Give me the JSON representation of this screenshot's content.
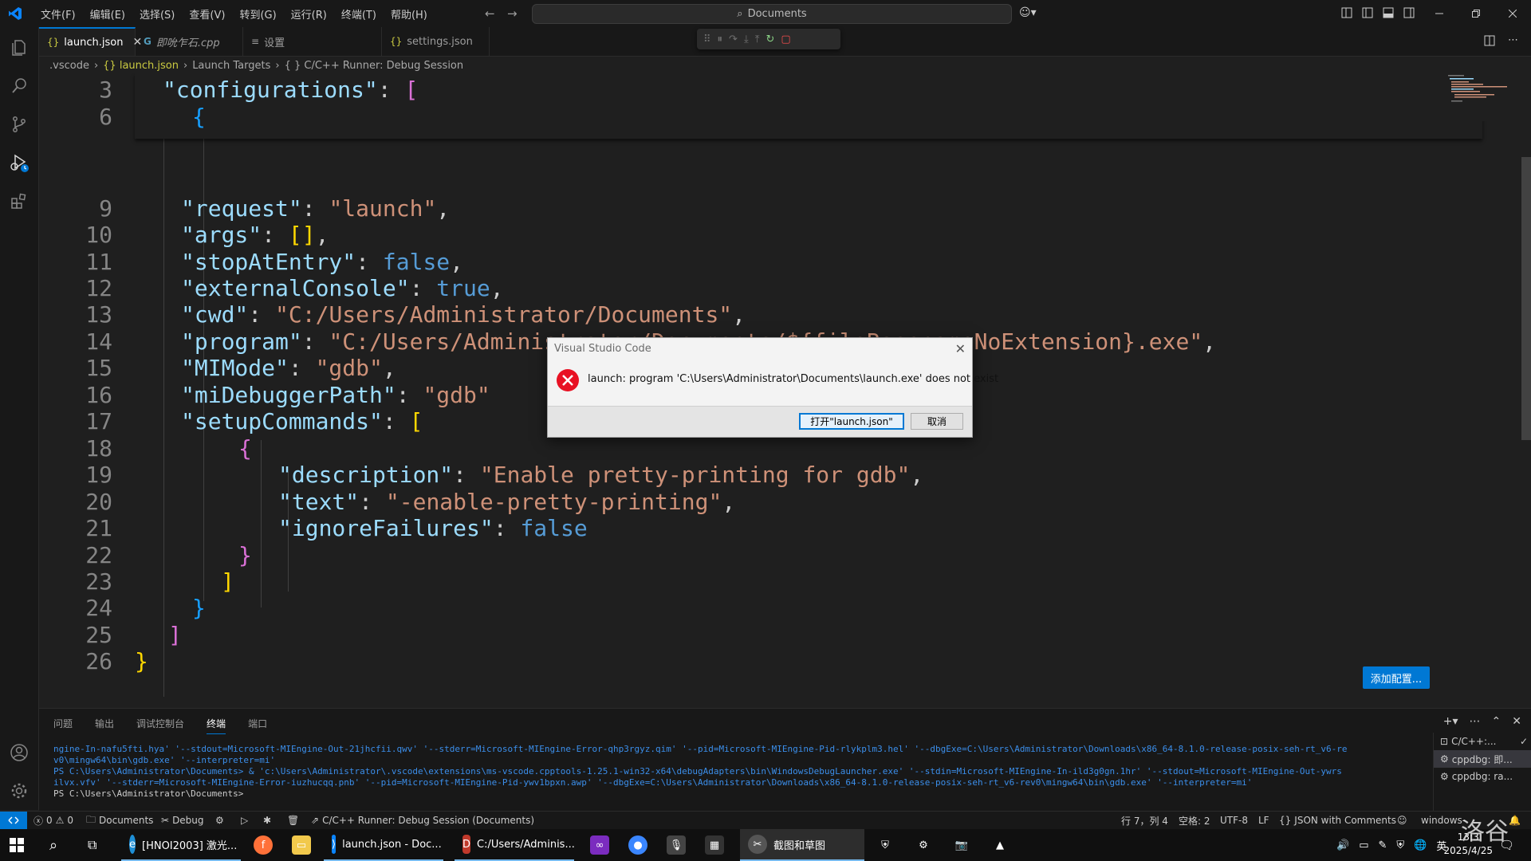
{
  "window": {
    "menu": [
      "文件(F)",
      "编辑(E)",
      "选择(S)",
      "查看(V)",
      "转到(G)",
      "运行(R)",
      "终端(T)",
      "帮助(H)"
    ],
    "search": "Documents"
  },
  "tabs": [
    {
      "label": "launch.json",
      "icon": "{}"
    },
    {
      "label": "即吮乍石.cpp",
      "icon": "G"
    },
    {
      "label": "设置",
      "icon": "≡"
    },
    {
      "label": "settings.json",
      "icon": "{}"
    }
  ],
  "breadcrumb": [
    ".vscode",
    "{} launch.json",
    "Launch Targets",
    "{ } C/C++ Runner: Debug Session"
  ],
  "editor": {
    "lines": [
      {
        "n": "3",
        "sticky": true
      },
      {
        "n": "6",
        "sticky": true
      },
      {
        "n": "9"
      },
      {
        "n": "10"
      },
      {
        "n": "11"
      },
      {
        "n": "12"
      },
      {
        "n": "13"
      },
      {
        "n": "14"
      },
      {
        "n": "15"
      },
      {
        "n": "16"
      },
      {
        "n": "17"
      },
      {
        "n": "18"
      },
      {
        "n": "19"
      },
      {
        "n": "20"
      },
      {
        "n": "21"
      },
      {
        "n": "22"
      },
      {
        "n": "23"
      },
      {
        "n": "24"
      },
      {
        "n": "25"
      },
      {
        "n": "26"
      }
    ],
    "tokens": {
      "configurations": "\"configurations\"",
      "request": "\"request\"",
      "launch": "\"launch\"",
      "args": "\"args\"",
      "stopAtEntry": "\"stopAtEntry\"",
      "false": "false",
      "externalConsole": "\"externalConsole\"",
      "true": "true",
      "cwd": "\"cwd\"",
      "cwd_val": "\"C:/Users/Administrator/Documents\"",
      "program": "\"program\"",
      "program_val": "\"C:/Users/Administrator/Documents/${fileBasenameNoExtension}.exe\"",
      "MIMode": "\"MIMode\"",
      "gdb": "\"gdb\"",
      "miDebuggerPath": "\"miDebuggerPath\"",
      "gdb_trunc": "\"gdb\"",
      "setupCommands": "\"setupCommands\"",
      "description": "\"description\"",
      "description_val": "\"Enable pretty-printing for gdb\"",
      "text": "\"text\"",
      "text_val": "\"-enable-pretty-printing\"",
      "ignoreFailures": "\"ignoreFailures\""
    },
    "add_config_button": "添加配置..."
  },
  "dialog": {
    "title": "Visual Studio Code",
    "message": "launch: program 'C:\\Users\\Administrator\\Documents\\launch.exe' does not exist",
    "primary": "打开\"launch.json\"",
    "cancel": "取消"
  },
  "panel": {
    "tabs": [
      "问题",
      "输出",
      "调试控制台",
      "终端",
      "端口"
    ],
    "active_tab": "终端",
    "terminal_lines": [
      "ngine-In-nafu5fti.hya' '--stdout=Microsoft-MIEngine-Out-21jhcfii.qwv' '--stderr=Microsoft-MIEngine-Error-qhp3rgyz.qim' '--pid=Microsoft-MIEngine-Pid-rlykplm3.hel' '--dbgExe=C:\\Users\\Administrator\\Downloads\\x86_64-8.1.0-release-posix-seh-rt_v6-re",
      "v0\\mingw64\\bin\\gdb.exe' '--interpreter=mi'",
      "PS C:\\Users\\Administrator\\Documents>  & 'c:\\Users\\Administrator\\.vscode\\extensions\\ms-vscode.cpptools-1.25.1-win32-x64\\debugAdapters\\bin\\WindowsDebugLauncher.exe' '--stdin=Microsoft-MIEngine-In-ild3g0gn.1hr' '--stdout=Microsoft-MIEngine-Out-ywrs",
      "ilvx.vfv' '--stderr=Microsoft-MIEngine-Error-iuzhucqq.pnb' '--pid=Microsoft-MIEngine-Pid-ywv1bpxn.awp' '--dbgExe=C:\\Users\\Administrator\\Downloads\\x86_64-8.1.0-release-posix-seh-rt_v6-rev0\\mingw64\\bin\\gdb.exe' '--interpreter=mi'",
      "PS C:\\Users\\Administrator\\Documents>"
    ],
    "terminal_list": [
      "C/C++:...",
      "cppdbg: 即...",
      "cppdbg: ra..."
    ]
  },
  "status": {
    "errors": "0",
    "warnings": "0",
    "folder": "Documents",
    "debug": "Debug",
    "session": "C/C++ Runner: Debug Session (Documents)",
    "position": "行 7，列 4",
    "spaces": "空格: 2",
    "encoding": "UTF-8",
    "eol": "LF",
    "language": "JSON with Comments",
    "platform": "windows-"
  },
  "taskbar": {
    "apps": [
      "[HNOI2003] 激光...",
      "launch.json - Doc...",
      "C:/Users/Adminis...",
      "截图和草图"
    ],
    "time": "13:3",
    "date": "2025/4/25",
    "ime": "英"
  },
  "watermark": "洛谷",
  "colors": {
    "accent": "#0078d4",
    "error": "#e81123",
    "string": "#ce9178",
    "key": "#9cdcfe",
    "keyword": "#569cd6"
  }
}
